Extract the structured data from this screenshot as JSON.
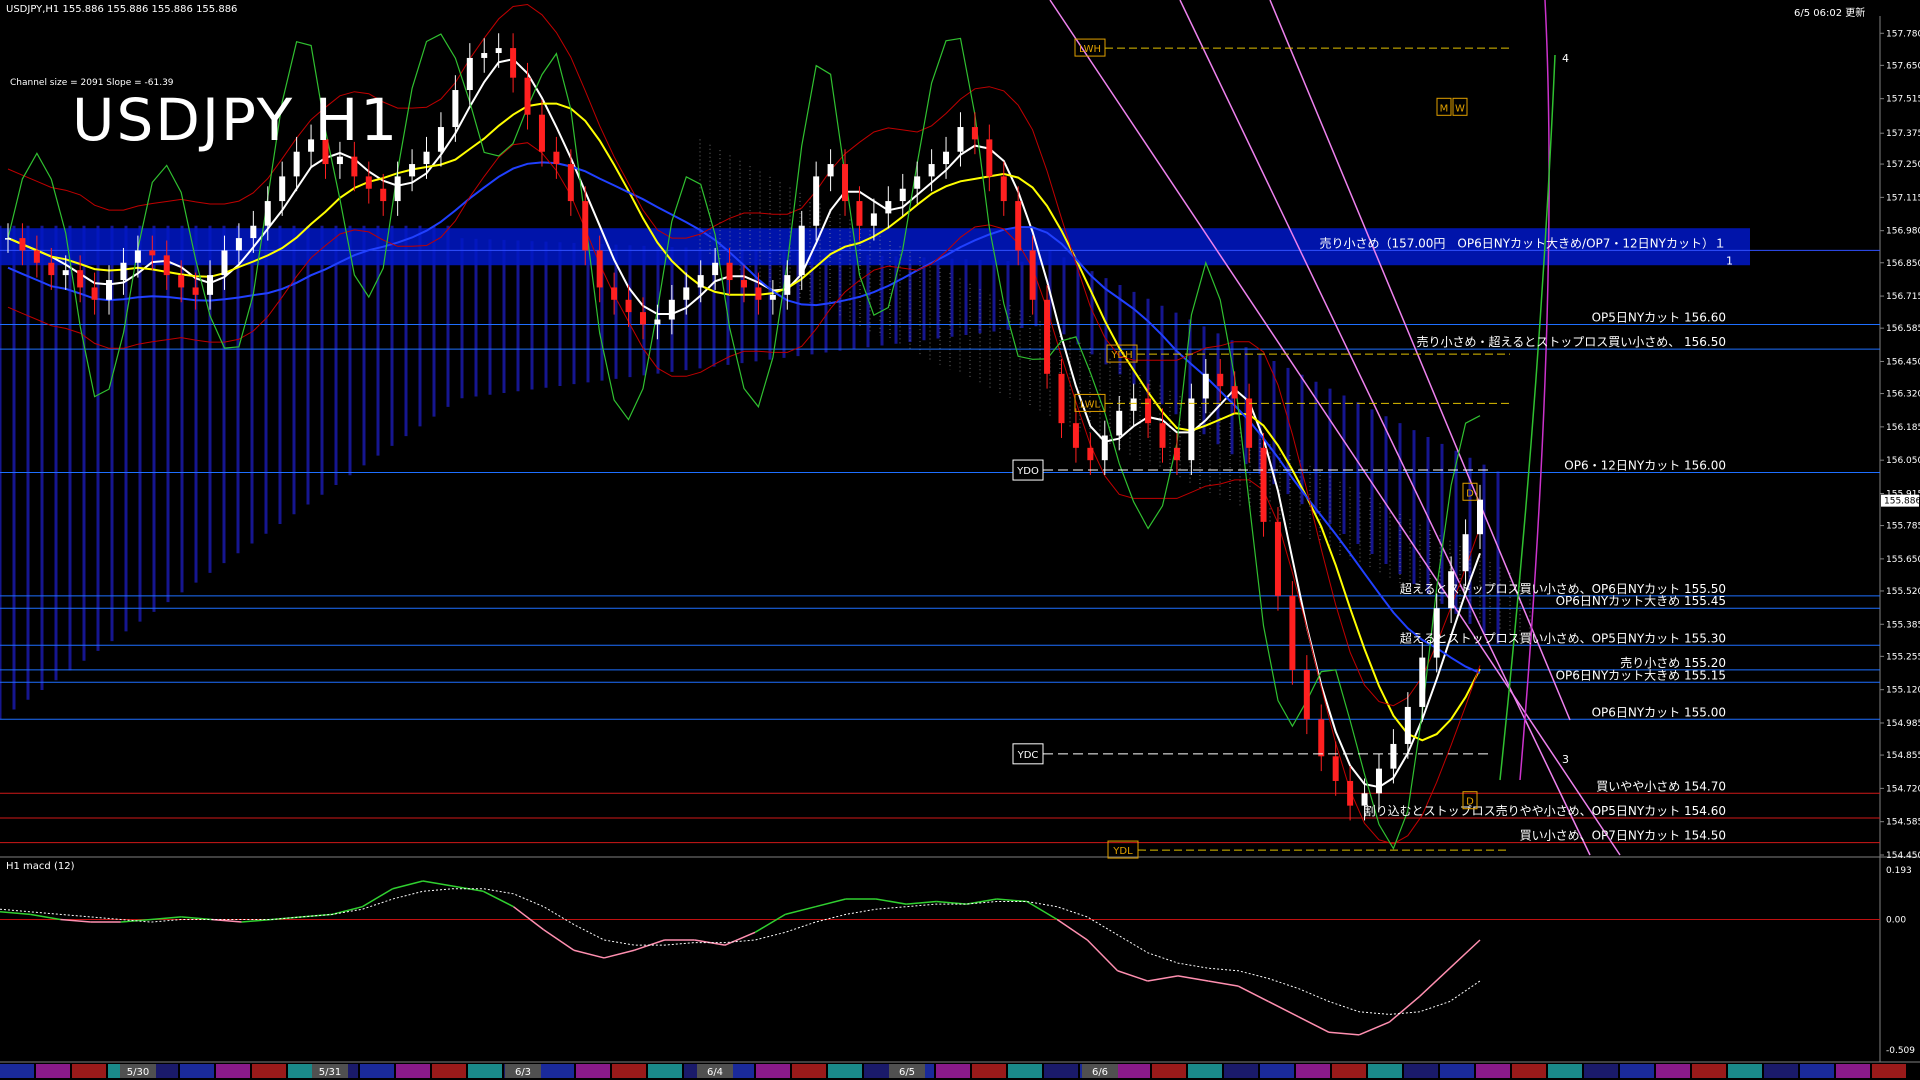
{
  "header": {
    "symbol_info": "USDJPY,H1  155.886 155.886 155.886 155.886",
    "timestamp": "6/5 06:02 更新",
    "channel_info": "Channel size = 2091 Slope = -61.39",
    "chart_title": "USDJPY H1",
    "macd_label": "H1 macd (12)"
  },
  "chart_data": [
    {
      "type": "candlestick",
      "title": "USDJPY H1",
      "y_ticks": [
        "157.780",
        "157.650",
        "157.515",
        "157.375",
        "157.250",
        "157.115",
        "156.980",
        "156.850",
        "156.715",
        "156.585",
        "156.450",
        "156.320",
        "156.185",
        "156.050",
        "155.915",
        "155.785",
        "155.650",
        "155.520",
        "155.385",
        "155.255",
        "155.120",
        "154.985",
        "154.855",
        "154.720",
        "154.585",
        "154.450"
      ],
      "ylim": [
        154.45,
        157.85
      ],
      "current_price": "155.886",
      "x_labels": [
        "5/30",
        "5/31",
        "6/3",
        "6/4",
        "6/5",
        "6/6"
      ],
      "price_lines": [
        {
          "label": "売り小さめ（157.00円　OP6日NYカット大きめ/OP7・12日NYカット）１",
          "price": 156.9,
          "color": "#3050ff"
        },
        {
          "label": "OP5日NYカット 156.60",
          "price": 156.6,
          "color": "#1e6fff"
        },
        {
          "label": "売り小さめ・超えるとストップロス買い小さめ、 156.50",
          "price": 156.5,
          "color": "#1e6fff"
        },
        {
          "label": "OP6・12日NYカット 156.00",
          "price": 156.0,
          "color": "#1e6fff"
        },
        {
          "label": "超えるとストップロス買い小さめ、OP6日NYカット 155.50",
          "price": 155.5,
          "color": "#1e6fff"
        },
        {
          "label": "OP6日NYカット大きめ 155.45",
          "price": 155.45,
          "color": "#1e6fff"
        },
        {
          "label": "超えるとストップロス買い小さめ、OP5日NYカット 155.30",
          "price": 155.3,
          "color": "#1e6fff"
        },
        {
          "label": "売り小さめ 155.20",
          "price": 155.2,
          "color": "#1e6fff"
        },
        {
          "label": "OP6日NYカット大きめ 155.15",
          "price": 155.15,
          "color": "#1e6fff"
        },
        {
          "label": "OP6日NYカット 155.00",
          "price": 155.0,
          "color": "#1e6fff"
        },
        {
          "label": "買いやや小さめ 154.70",
          "price": 154.7,
          "color": "#d01818"
        },
        {
          "label": "割り込むとストップロス売りやや小さめ、OP5日NYカット 154.60",
          "price": 154.6,
          "color": "#d01818"
        },
        {
          "label": "買い小さめ、OP7日NYカット 154.50",
          "price": 154.5,
          "color": "#d01818"
        }
      ],
      "markers": [
        {
          "label": "LWH",
          "price": 157.72
        },
        {
          "label": "YDH",
          "price": 156.48
        },
        {
          "label": "LWL",
          "price": 156.28
        },
        {
          "label": "YDO",
          "price": 156.01
        },
        {
          "label": "YDC",
          "price": 154.86
        },
        {
          "label": "YDL",
          "price": 154.47
        },
        {
          "label": "M",
          "price": 157.48
        },
        {
          "label": "W",
          "price": 157.48
        },
        {
          "label": "D",
          "price": 155.92
        },
        {
          "label": "D",
          "price": 154.67
        },
        {
          "label": "1",
          "price": 156.86
        },
        {
          "label": "3",
          "price": 154.84
        },
        {
          "label": "4",
          "price": 157.68
        }
      ],
      "series": [
        {
          "name": "close",
          "values": [
            156.95,
            156.9,
            156.85,
            156.8,
            156.82,
            156.75,
            156.7,
            156.78,
            156.85,
            156.9,
            156.88,
            156.8,
            156.75,
            156.72,
            156.8,
            156.9,
            156.95,
            157.0,
            157.1,
            157.2,
            157.3,
            157.35,
            157.25,
            157.28,
            157.2,
            157.15,
            157.1,
            157.2,
            157.25,
            157.3,
            157.4,
            157.55,
            157.68,
            157.7,
            157.72,
            157.6,
            157.45,
            157.3,
            157.25,
            157.1,
            156.9,
            156.75,
            156.7,
            156.65,
            156.6,
            156.62,
            156.7,
            156.75,
            156.8,
            156.85,
            156.78,
            156.75,
            156.7,
            156.72,
            156.8,
            157.0,
            157.2,
            157.25,
            157.1,
            157.0,
            157.05,
            157.1,
            157.15,
            157.2,
            157.25,
            157.3,
            157.4,
            157.35,
            157.2,
            157.1,
            156.9,
            156.7,
            156.4,
            156.2,
            156.1,
            156.05,
            156.15,
            156.25,
            156.3,
            156.2,
            156.1,
            156.05,
            156.3,
            156.4,
            156.35,
            156.3,
            156.1,
            155.8,
            155.5,
            155.2,
            155.0,
            154.85,
            154.75,
            154.65,
            154.7,
            154.8,
            154.9,
            155.05,
            155.25,
            155.45,
            155.6,
            155.75,
            155.89
          ]
        }
      ]
    },
    {
      "type": "line",
      "title": "H1 macd (12)",
      "y_ticks": [
        "0.193",
        "0.00",
        "-0.509"
      ],
      "ylim": [
        -0.509,
        0.193
      ],
      "series": [
        {
          "name": "macd",
          "values": [
            0.03,
            0.02,
            0.0,
            -0.01,
            -0.01,
            0.0,
            0.01,
            0.0,
            -0.01,
            0.0,
            0.01,
            0.02,
            0.05,
            0.12,
            0.15,
            0.13,
            0.11,
            0.05,
            -0.04,
            -0.12,
            -0.15,
            -0.12,
            -0.08,
            -0.08,
            -0.1,
            -0.05,
            0.02,
            0.05,
            0.08,
            0.08,
            0.06,
            0.07,
            0.06,
            0.08,
            0.07,
            0.0,
            -0.08,
            -0.2,
            -0.24,
            -0.22,
            -0.24,
            -0.26,
            -0.32,
            -0.38,
            -0.44,
            -0.45,
            -0.4,
            -0.3,
            -0.19,
            -0.08
          ]
        },
        {
          "name": "signal",
          "values": [
            0.04,
            0.03,
            0.02,
            0.01,
            0.0,
            -0.01,
            0.0,
            0.0,
            0.0,
            0.0,
            0.01,
            0.02,
            0.04,
            0.08,
            0.11,
            0.12,
            0.12,
            0.1,
            0.05,
            -0.02,
            -0.08,
            -0.1,
            -0.1,
            -0.09,
            -0.09,
            -0.08,
            -0.05,
            -0.01,
            0.02,
            0.04,
            0.05,
            0.06,
            0.06,
            0.07,
            0.07,
            0.05,
            0.01,
            -0.06,
            -0.13,
            -0.17,
            -0.19,
            -0.2,
            -0.23,
            -0.27,
            -0.32,
            -0.36,
            -0.37,
            -0.36,
            -0.32,
            -0.24
          ]
        }
      ]
    }
  ],
  "colors": {
    "candle_up": "#ffffff",
    "candle_down": "#ff2020",
    "cloud": "#1a1aa8",
    "macd_line": "#30d030",
    "macd_line_neg": "#ff8fb0",
    "signal_line": "#ffffff",
    "zero_line": "#c01010",
    "channel": "#ee82ee",
    "ma_white": "#ffffff",
    "ma_yellow": "#ffff00",
    "ma_blue": "#2040ff",
    "bollinger": "#c00000",
    "green_line": "#30c030"
  }
}
